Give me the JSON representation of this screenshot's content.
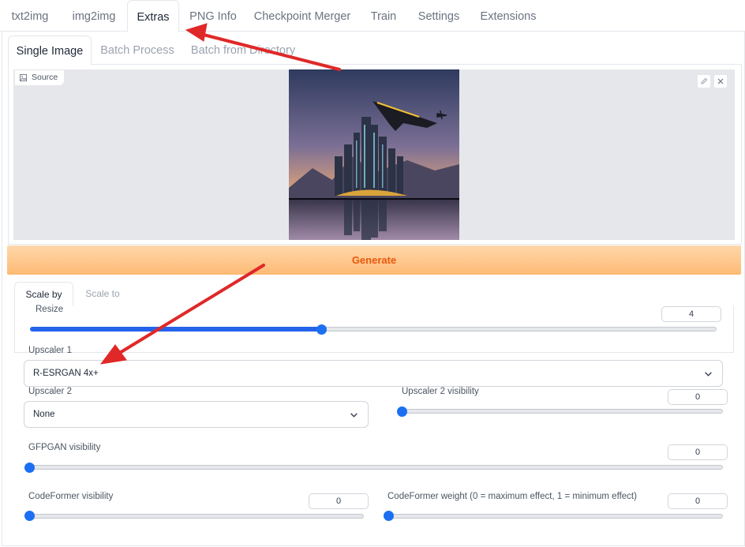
{
  "top_tabs": [
    "txt2img",
    "img2img",
    "Extras",
    "PNG Info",
    "Checkpoint Merger",
    "Train",
    "Settings",
    "Extensions"
  ],
  "sub_tabs": [
    "Single Image",
    "Batch Process",
    "Batch from Directory"
  ],
  "image": {
    "source_label": "Source",
    "edit_icon": "pencil-icon",
    "close_icon": "close-icon"
  },
  "generate_label": "Generate",
  "scale_tabs": [
    "Scale by",
    "Scale to"
  ],
  "resize": {
    "label": "Resize",
    "value": "4",
    "fraction": 0.425
  },
  "upscaler1": {
    "label": "Upscaler 1",
    "value": "R-ESRGAN 4x+"
  },
  "upscaler2": {
    "label": "Upscaler 2",
    "value": "None"
  },
  "upscaler2_visibility": {
    "label": "Upscaler 2 visibility",
    "value": "0",
    "fraction": 0
  },
  "gfpgan": {
    "label": "GFPGAN visibility",
    "value": "0",
    "fraction": 0
  },
  "codeformer_visibility": {
    "label": "CodeFormer visibility",
    "value": "0",
    "fraction": 0
  },
  "codeformer_weight": {
    "label": "CodeFormer weight (0 = maximum effect, 1 = minimum effect)",
    "value": "0",
    "fraction": 0
  },
  "colors": {
    "accent": "#ea580c",
    "slider": "#2563eb",
    "annotation": "#e02828"
  }
}
